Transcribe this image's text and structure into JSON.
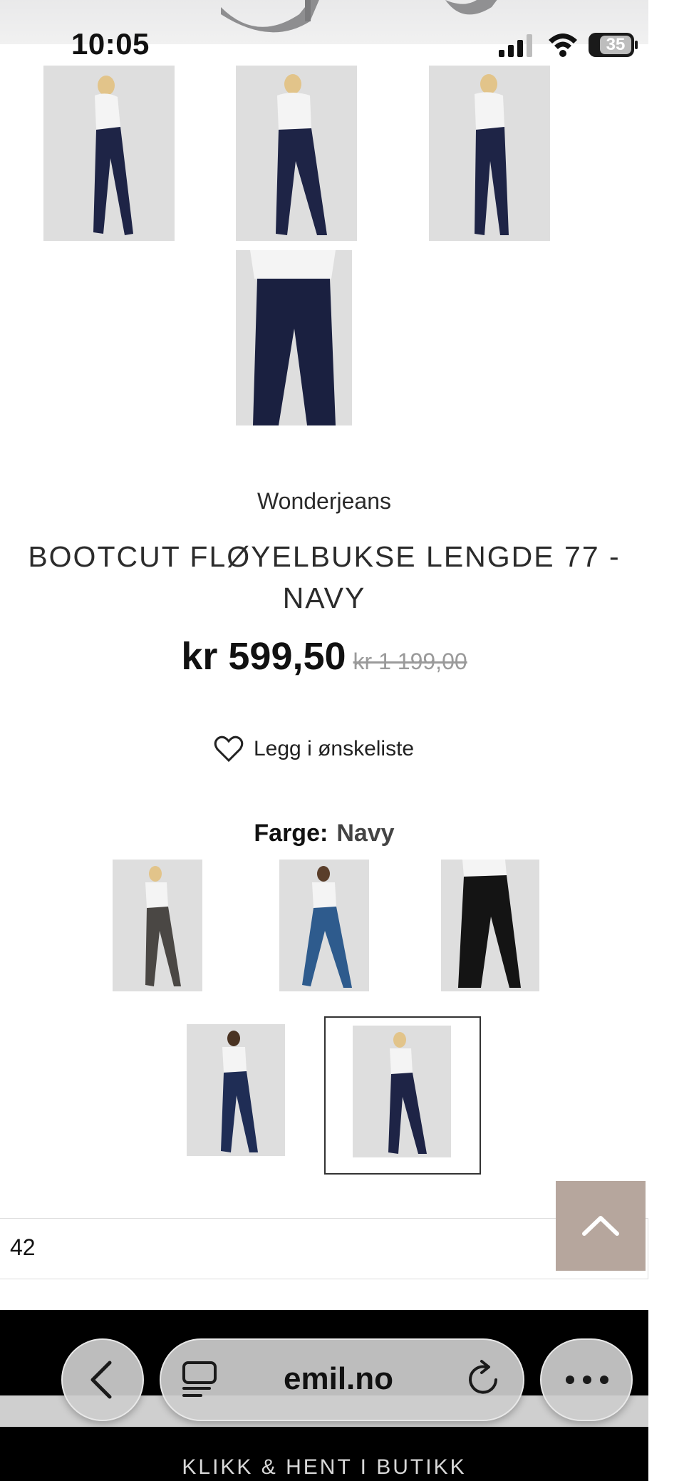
{
  "status_bar": {
    "time": "10:05",
    "battery": "35"
  },
  "product": {
    "brand": "Wonderjeans",
    "title": "BOOTCUT FLØYELBUKSE LENGDE 77 - NAVY",
    "price": "kr 599,50",
    "old_price": "kr 1 199,00"
  },
  "wishlist": {
    "label": "Legg i ønskeliste",
    "icon": "heart-icon"
  },
  "color": {
    "label": "Farge:",
    "value": "Navy"
  },
  "color_swatches": [
    {
      "name": "grey",
      "color": "#4a4744"
    },
    {
      "name": "blue",
      "color": "#2e5b8d"
    },
    {
      "name": "black",
      "color": "#141414"
    },
    {
      "name": "dark-blue",
      "color": "#1f2d55"
    },
    {
      "name": "navy",
      "color": "#1e2446",
      "selected": true
    }
  ],
  "size": {
    "value": "42"
  },
  "footer": {
    "cta": "KLIKK & HENT I BUTIKK"
  },
  "browser": {
    "url": "emil.no"
  },
  "colors": {
    "navy": "#1e2446",
    "scroll_top_bg": "#b6a69d",
    "black": "#000000"
  }
}
